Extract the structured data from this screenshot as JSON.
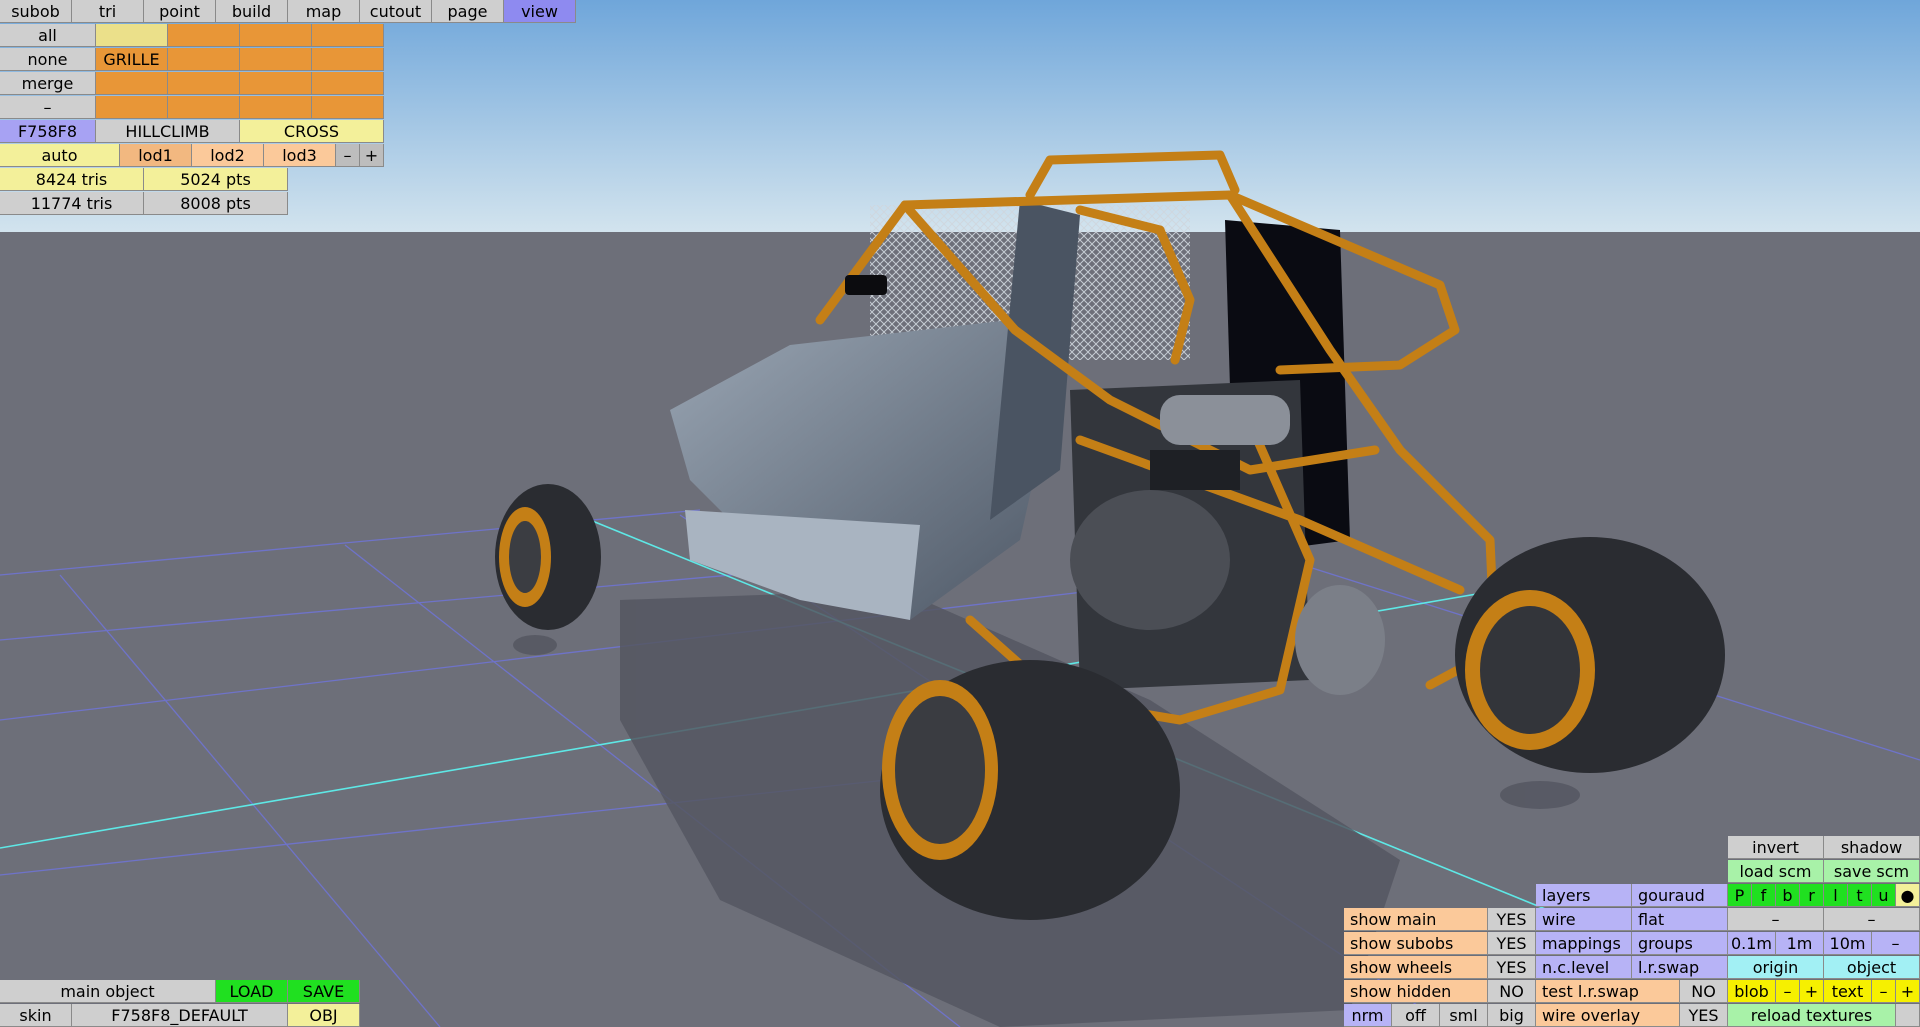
{
  "top_menu": {
    "items": [
      "subob",
      "tri",
      "point",
      "build",
      "map",
      "cutout",
      "page",
      "view"
    ],
    "active": "view"
  },
  "subobject_panel": {
    "rows": [
      {
        "label": "all",
        "cells": [
          "",
          "",
          "",
          ""
        ]
      },
      {
        "label": "none",
        "cells": [
          "GRILLE",
          "",
          "",
          ""
        ]
      },
      {
        "label": "merge",
        "cells": [
          "",
          "",
          "",
          ""
        ]
      },
      {
        "label": "–",
        "cells": [
          "",
          "",
          "",
          ""
        ]
      }
    ]
  },
  "variants": {
    "code": "F758F8",
    "hillclimb": "HILLCLIMB",
    "cross": "CROSS"
  },
  "lod": {
    "auto": "auto",
    "lod1": "lod1",
    "lod2": "lod2",
    "lod3": "lod3",
    "minus": "–",
    "plus": "+"
  },
  "stats": {
    "tris1": "8424 tris",
    "pts1": "5024 pts",
    "tris2": "11774 tris",
    "pts2": "8008 pts"
  },
  "bottom_left": {
    "main_object": "main object",
    "load": "LOAD",
    "save": "SAVE",
    "skin": "skin",
    "skin_name": "F758F8_DEFAULT",
    "obj": "OBJ"
  },
  "view_panel": {
    "invert": "invert",
    "shadow": "shadow",
    "load_scm": "load scm",
    "save_scm": "save scm",
    "layer_buttons": [
      "P",
      "f",
      "b",
      "r",
      "l",
      "t",
      "u"
    ],
    "dot": "●",
    "layers": "layers",
    "gouraud": "gouraud",
    "wire": "wire",
    "flat": "flat",
    "mappings": "mappings",
    "groups": "groups",
    "nc_level": "n.c.level",
    "lr_swap": "l.r.swap",
    "test_lr_swap": "test l.r.swap",
    "test_lr_swap_val": "NO",
    "wire_overlay": "wire overlay",
    "wire_overlay_val": "YES",
    "show_main": "show main",
    "show_main_val": "YES",
    "show_subobs": "show subobs",
    "show_subobs_val": "YES",
    "show_wheels": "show wheels",
    "show_wheels_val": "YES",
    "show_hidden": "show hidden",
    "show_hidden_val": "NO",
    "nrm": "nrm",
    "off": "off",
    "sml": "sml",
    "big": "big",
    "dash1": "–",
    "dash2": "–",
    "grid": [
      "0.1m",
      "1m",
      "10m",
      "–"
    ],
    "origin": "origin",
    "object": "object",
    "blob": "blob",
    "text": "text",
    "minus": "–",
    "plus": "+",
    "reload_textures": "reload textures"
  },
  "colors": {
    "sky_top": "#6fa6da",
    "sky_bottom": "#cfe2ee",
    "ground": "#6d6f79",
    "roll_cage": "#c47f16",
    "tire": "#2a2c31",
    "body_panel": "#6c7785"
  }
}
